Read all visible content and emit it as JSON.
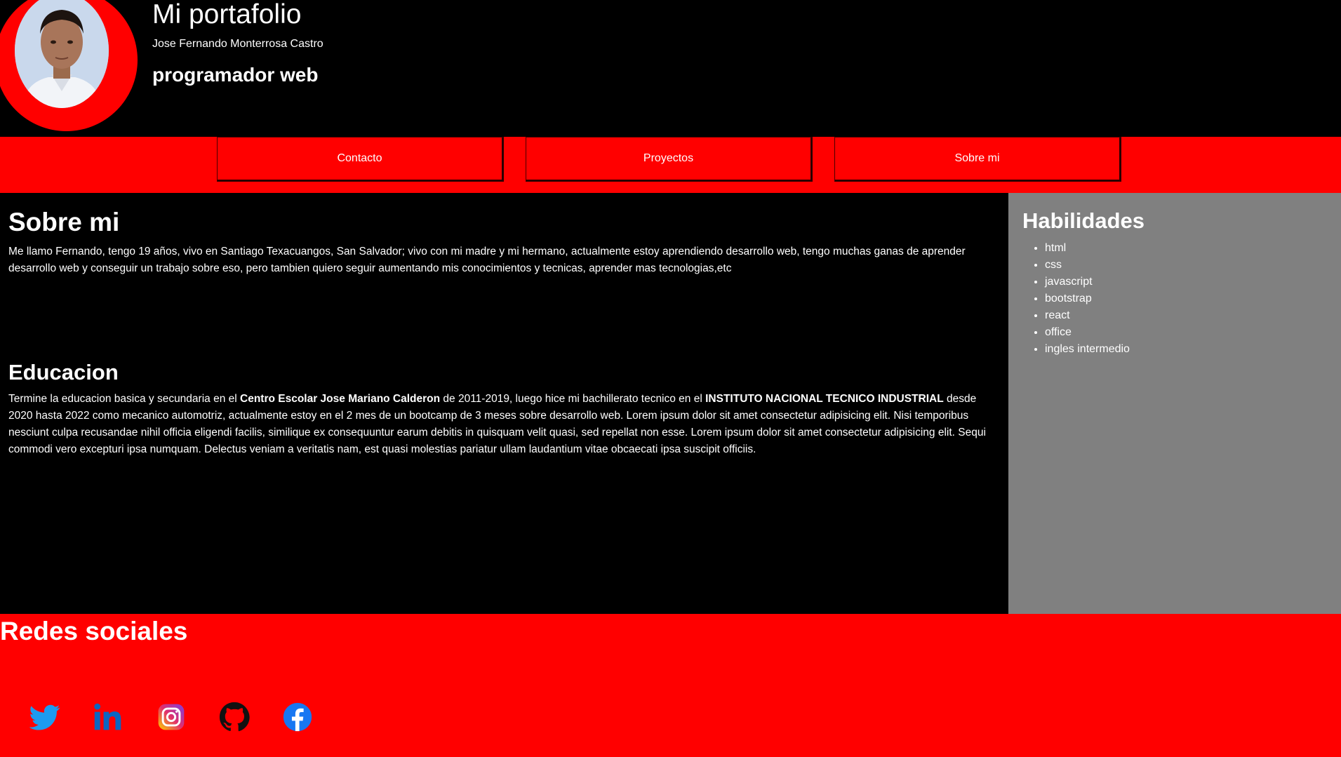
{
  "header": {
    "title": "Mi portafolio",
    "name": "Jose Fernando Monterrosa Castro",
    "role": "programador web"
  },
  "nav": {
    "items": [
      "Contacto",
      "Proyectos",
      "Sobre mi"
    ]
  },
  "about": {
    "heading": "Sobre mi",
    "text": "Me llamo Fernando, tengo 19 años, vivo en Santiago Texacuangos, San Salvador; vivo con mi madre y mi hermano, actualmente estoy aprendiendo desarrollo web, tengo muchas ganas de aprender desarrollo web y conseguir un trabajo sobre eso, pero tambien quiero seguir aumentando mis conocimientos y tecnicas, aprender mas tecnologias,etc"
  },
  "education": {
    "heading": "Educacion",
    "text_1": "Termine la educacion basica y secundaria en el ",
    "school": "Centro Escolar Jose Mariano Calderon",
    "text_2": " de 2011-2019, luego hice mi bachillerato tecnico en el ",
    "institute": "INSTITUTO NACIONAL TECNICO INDUSTRIAL",
    "text_3": " desde 2020 hasta 2022 como mecanico automotriz, actualmente estoy en el 2 mes de un bootcamp de 3 meses sobre desarrollo web. Lorem ipsum dolor sit amet consectetur adipisicing elit. Nisi temporibus nesciunt culpa recusandae nihil officia eligendi facilis, similique ex consequuntur earum debitis in quisquam velit quasi, sed repellat non esse. Lorem ipsum dolor sit amet consectetur adipisicing elit. Sequi commodi vero excepturi ipsa numquam. Delectus veniam a veritatis nam, est quasi molestias pariatur ullam laudantium vitae obcaecati ipsa suscipit officiis."
  },
  "skills": {
    "heading": "Habilidades",
    "items": [
      "html",
      "css",
      "javascript",
      "bootstrap",
      "react",
      "office",
      "ingles intermedio"
    ]
  },
  "footer": {
    "heading": "Redes sociales",
    "icons": [
      "twitter-icon",
      "linkedin-icon",
      "instagram-icon",
      "github-icon",
      "facebook-icon"
    ]
  },
  "colors": {
    "accent": "#ff0000",
    "background": "#000000",
    "sidebar": "#808080",
    "twitter": "#1d9bf0",
    "linkedin": "#0a66c2",
    "facebook": "#1877f2"
  }
}
